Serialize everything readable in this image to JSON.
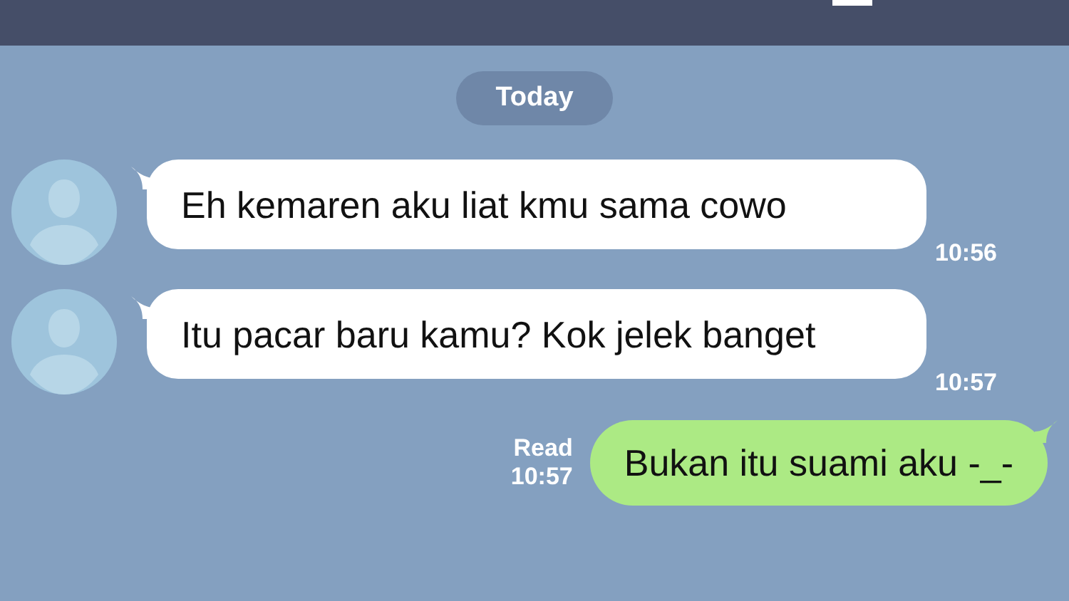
{
  "date_chip": "Today",
  "messages": [
    {
      "kind": "incoming",
      "text": "Eh kemaren aku liat kmu sama cowo",
      "time": "10:56"
    },
    {
      "kind": "incoming",
      "text": "Itu pacar baru kamu? Kok jelek banget",
      "time": "10:57"
    },
    {
      "kind": "outgoing",
      "text": "Bukan itu suami aku -_-",
      "read_label": "Read",
      "time": "10:57"
    }
  ]
}
